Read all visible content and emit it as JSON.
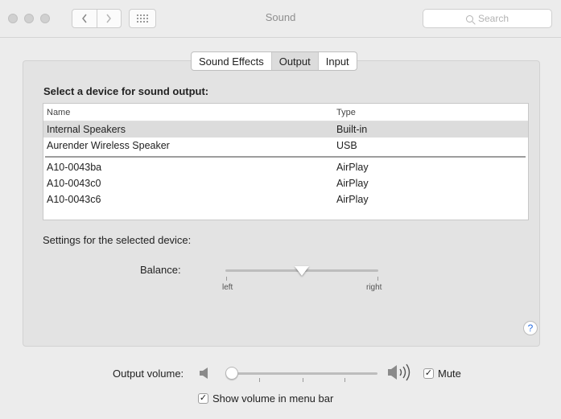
{
  "window": {
    "title": "Sound",
    "search_placeholder": "Search"
  },
  "tabs": [
    {
      "label": "Sound Effects",
      "selected": false
    },
    {
      "label": "Output",
      "selected": true
    },
    {
      "label": "Input",
      "selected": false
    }
  ],
  "output": {
    "heading": "Select a device for sound output:",
    "columns": {
      "name": "Name",
      "type": "Type"
    },
    "devices": [
      {
        "name": "Internal Speakers",
        "type": "Built-in",
        "selected": true
      },
      {
        "name": "Aurender Wireless Speaker",
        "type": "USB",
        "selected": false
      },
      {
        "name": "A10-0043ba",
        "type": "AirPlay",
        "selected": false
      },
      {
        "name": "A10-0043c0",
        "type": "AirPlay",
        "selected": false
      },
      {
        "name": "A10-0043c6",
        "type": "AirPlay",
        "selected": false
      }
    ],
    "settings_label": "Settings for the selected device:",
    "balance": {
      "label": "Balance:",
      "left_label": "left",
      "right_label": "right",
      "value": 0.5
    }
  },
  "help_symbol": "?",
  "volume": {
    "label": "Output volume:",
    "value": 0.03,
    "mute_label": "Mute",
    "mute_checked": true,
    "show_in_menu_bar_label": "Show volume in menu bar",
    "show_in_menu_bar_checked": true
  }
}
